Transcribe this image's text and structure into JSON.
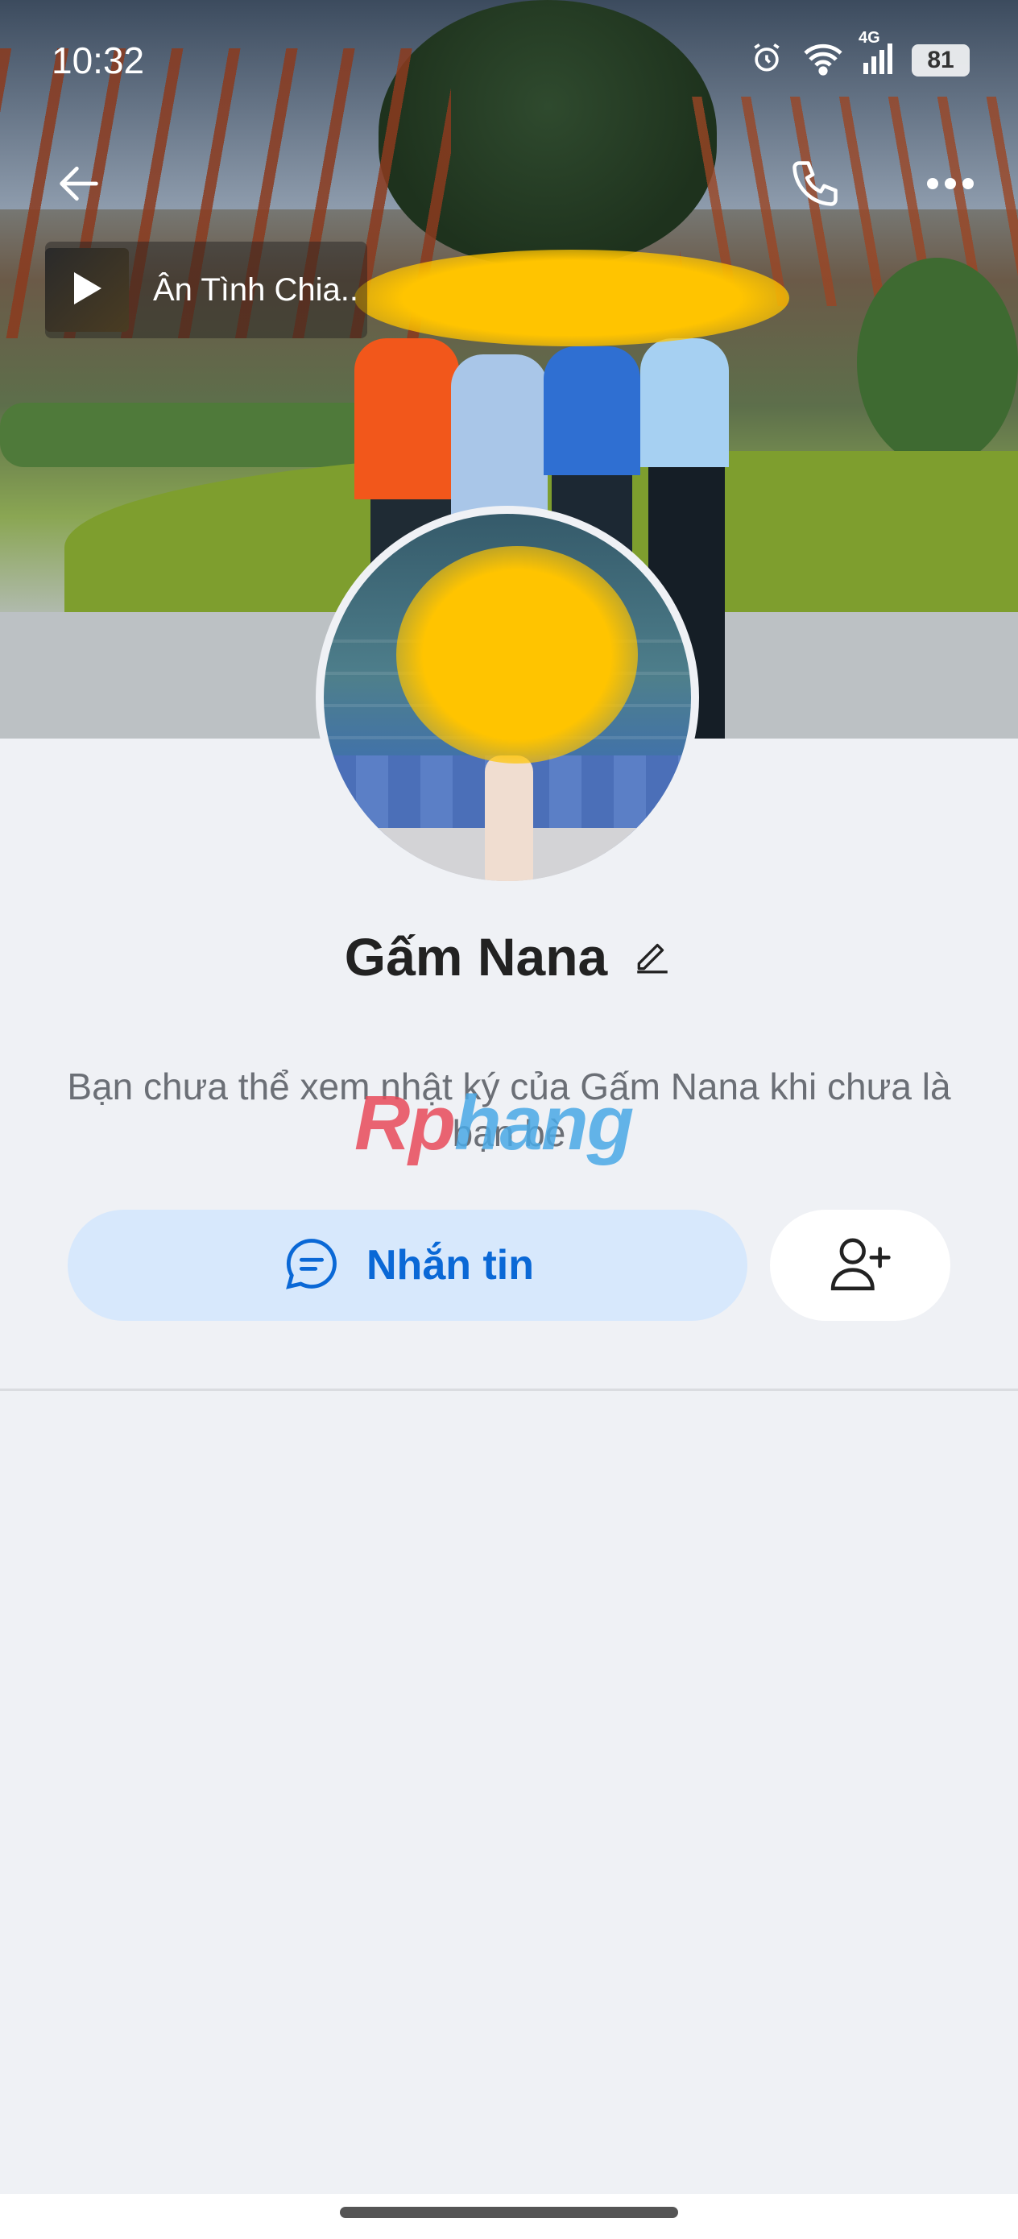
{
  "status_bar": {
    "time": "10:32",
    "network": "4G",
    "battery": "81"
  },
  "header": {
    "back_icon": "arrow-left-icon",
    "call_icon": "phone-icon",
    "more_icon": "ellipsis-icon"
  },
  "music": {
    "title": "Ân Tình Chia.."
  },
  "profile": {
    "name": "Gấm Nana",
    "info_text": "Bạn chưa thể xem nhật ký của Gấm Nana khi chưa là bạn bè"
  },
  "actions": {
    "message_label": "Nhắn tin",
    "message_icon": "chat-bubble-icon",
    "add_friend_icon": "add-user-icon"
  },
  "watermark": {
    "part1": "Rp",
    "part2": "hang"
  },
  "colors": {
    "accent": "#0a68d6",
    "message_bg": "#d7e8fc",
    "page_bg": "#eff1f5"
  }
}
